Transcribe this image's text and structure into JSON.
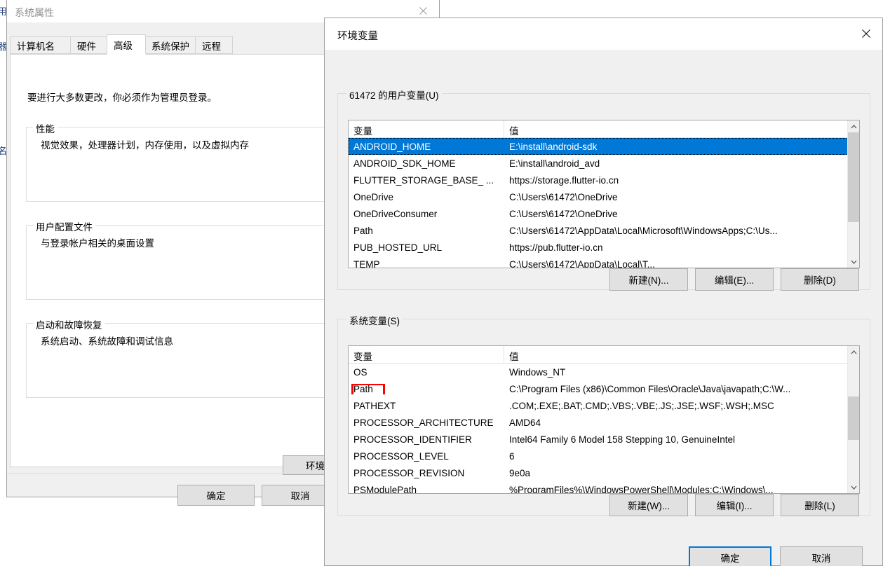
{
  "background_window": {
    "fragments": [
      "用",
      "器",
      "名"
    ]
  },
  "system_properties": {
    "title": "系统属性",
    "close_icon": "close-icon",
    "tabs": [
      {
        "label": "计算机名",
        "active": false
      },
      {
        "label": "硬件",
        "active": false
      },
      {
        "label": "高级",
        "active": true
      },
      {
        "label": "系统保护",
        "active": false
      },
      {
        "label": "远程",
        "active": false
      }
    ],
    "intro_text": "要进行大多数更改，你必须作为管理员登录。",
    "groups": [
      {
        "label": "性能",
        "text": "视觉效果，处理器计划，内存使用，以及虚拟内存"
      },
      {
        "label": "用户配置文件",
        "text": "与登录帐户相关的桌面设置"
      },
      {
        "label": "启动和故障恢复",
        "text": "系统启动、系统故障和调试信息"
      }
    ],
    "env_button_label": "环境变量(N)...",
    "footer": {
      "ok_label": "确定",
      "cancel_label": "取消"
    }
  },
  "environment_variables": {
    "title": "环境变量",
    "close_icon": "close-icon",
    "user_section": {
      "label": "61472 的用户变量(U)",
      "columns": [
        "变量",
        "值"
      ],
      "rows": [
        {
          "name": "ANDROID_HOME",
          "value": "E:\\install\\android-sdk",
          "selected": true
        },
        {
          "name": "ANDROID_SDK_HOME",
          "value": "E:\\install\\android_avd",
          "selected": false
        },
        {
          "name": "FLUTTER_STORAGE_BASE_ ...",
          "value": "https://storage.flutter-io.cn",
          "selected": false
        },
        {
          "name": "OneDrive",
          "value": "C:\\Users\\61472\\OneDrive",
          "selected": false
        },
        {
          "name": "OneDriveConsumer",
          "value": "C:\\Users\\61472\\OneDrive",
          "selected": false
        },
        {
          "name": "Path",
          "value": "C:\\Users\\61472\\AppData\\Local\\Microsoft\\WindowsApps;C:\\Us...",
          "selected": false
        },
        {
          "name": "PUB_HOSTED_URL",
          "value": "https://pub.flutter-io.cn",
          "selected": false
        },
        {
          "name": "TEMP",
          "value": "C:\\Users\\61472\\AppData\\Local\\T...",
          "selected": false
        }
      ],
      "buttons": {
        "new_label": "新建(N)...",
        "edit_label": "编辑(E)...",
        "delete_label": "删除(D)"
      }
    },
    "system_section": {
      "label": "系统变量(S)",
      "columns": [
        "变量",
        "值"
      ],
      "rows": [
        {
          "name": "OS",
          "value": "Windows_NT",
          "marked": false
        },
        {
          "name": "Path",
          "value": "C:\\Program Files (x86)\\Common Files\\Oracle\\Java\\javapath;C:\\W...",
          "marked": true
        },
        {
          "name": "PATHEXT",
          "value": ".COM;.EXE;.BAT;.CMD;.VBS;.VBE;.JS;.JSE;.WSF;.WSH;.MSC",
          "marked": false
        },
        {
          "name": "PROCESSOR_ARCHITECTURE",
          "value": "AMD64",
          "marked": false
        },
        {
          "name": "PROCESSOR_IDENTIFIER",
          "value": "Intel64 Family 6 Model 158 Stepping 10, GenuineIntel",
          "marked": false
        },
        {
          "name": "PROCESSOR_LEVEL",
          "value": "6",
          "marked": false
        },
        {
          "name": "PROCESSOR_REVISION",
          "value": "9e0a",
          "marked": false
        },
        {
          "name": "PSModulePath",
          "value": "%ProgramFiles%\\WindowsPowerShell\\Modules;C:\\Windows\\...",
          "marked": false
        }
      ],
      "buttons": {
        "new_label": "新建(W)...",
        "edit_label": "编辑(I)...",
        "delete_label": "删除(L)"
      }
    },
    "footer": {
      "ok_label": "确定",
      "cancel_label": "取消"
    }
  },
  "colors": {
    "selection_blue": "#0078d7",
    "highlight_red": "#ff0000",
    "dialog_gray": "#f0f0f0",
    "button_face": "#e1e1e1"
  }
}
